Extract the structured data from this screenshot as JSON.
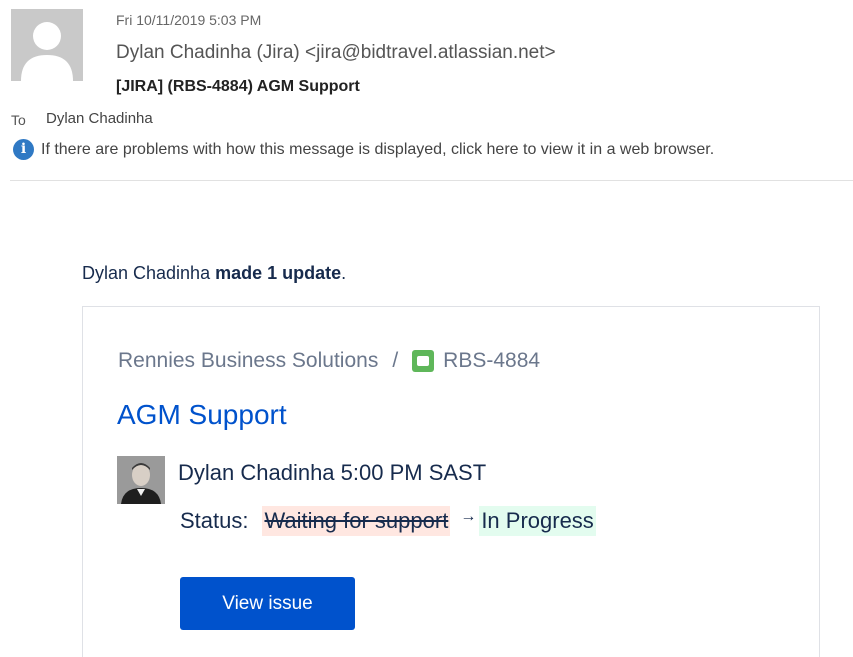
{
  "email": {
    "date": "Fri 10/11/2019 5:03 PM",
    "sender": "Dylan Chadinha (Jira) <jira@bidtravel.atlassian.net>",
    "subject": "[JIRA] (RBS-4884) AGM Support",
    "to_label": "To",
    "to_value": "Dylan Chadinha",
    "info_icon": "info-icon",
    "info_text": "If there are problems with how this message is displayed, click here to view it in a web browser."
  },
  "body": {
    "update_actor": "Dylan Chadinha",
    "update_action": "made 1 update",
    "update_period": "."
  },
  "card": {
    "project": "Rennies Business Solutions",
    "separator": "/",
    "issue_type_icon": "issue-type-icon",
    "issue_key": "RBS-4884",
    "issue_title": "AGM Support",
    "update_meta": "Dylan Chadinha 5:00 PM SAST",
    "status_label": "Status:",
    "old_status": "Waiting for support",
    "arrow": "→",
    "new_status": "In Progress",
    "button_label": "View issue"
  },
  "colors": {
    "link_blue": "#0052cc",
    "info_blue": "#2f79c4",
    "old_status_bg": "#ffe7e1",
    "new_status_bg": "#e3fcef",
    "issue_icon_green": "#5fb75a"
  }
}
